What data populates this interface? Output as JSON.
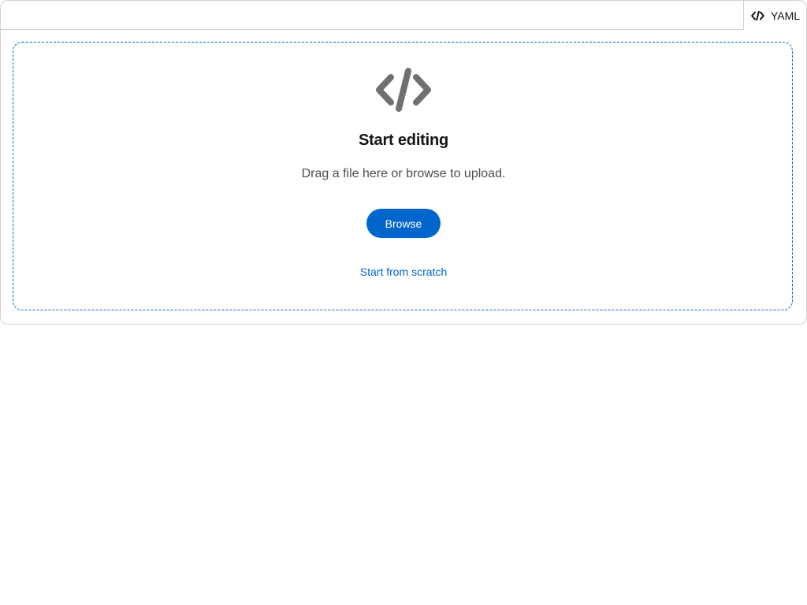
{
  "editor": {
    "language_label": "YAML",
    "language_icon": "code-icon"
  },
  "empty_state": {
    "icon": "code-icon",
    "title": "Start editing",
    "body": "Drag a file here or browse to upload.",
    "browse_label": "Browse",
    "scratch_label": "Start from scratch"
  },
  "colors": {
    "primary": "#0066cc",
    "icon_gray": "#707070",
    "title": "#151515",
    "body_text": "#4d4d4d",
    "border": "#d2d2d2"
  }
}
